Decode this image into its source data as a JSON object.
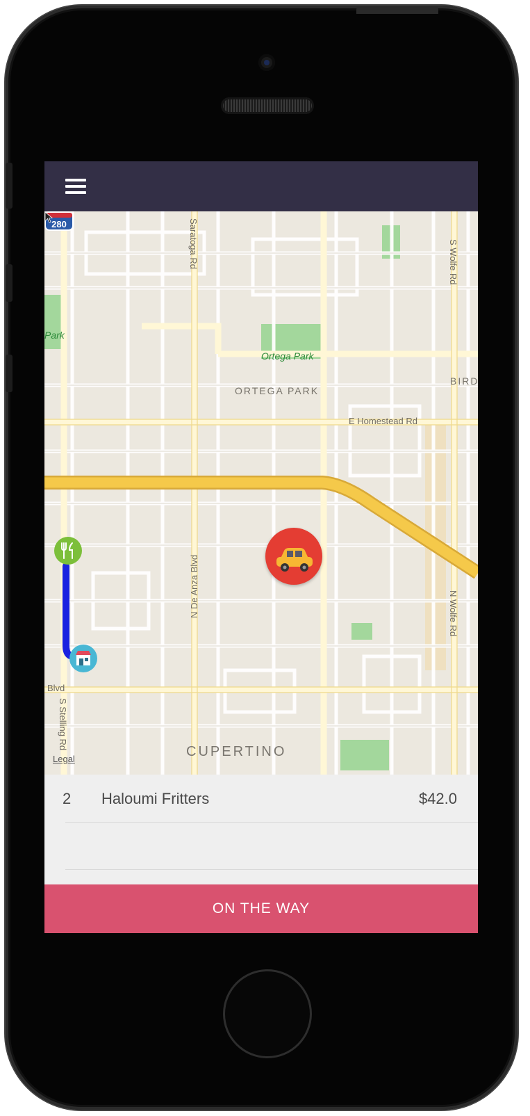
{
  "map": {
    "labels": {
      "road_saratoga": "Saratoga Rd",
      "road_wolfe_s": "S Wolfe Rd",
      "road_wolfe_n": "N Wolfe Rd",
      "road_homestead": "E Homestead Rd",
      "road_blvd": "Blvd",
      "road_stelling": "S Stelling Rd",
      "road_dana": "N De Anza Blvd",
      "park_west": "Park",
      "park_ortega": "Ortega Park",
      "area_ortega": "ORTEGA PARK",
      "area_bird": "BIRD",
      "city": "CUPERTINO",
      "highway": "280",
      "legal": "Legal"
    },
    "colors": {
      "route": "#1a22e0",
      "major_road": "#f5c94a",
      "park": "#9fd69a",
      "car_marker": "#e43d33"
    },
    "icons": [
      "menu-icon",
      "car-icon",
      "restaurant-icon",
      "store-icon",
      "cursor-icon"
    ]
  },
  "order": {
    "items": [
      {
        "qty": "2",
        "name": "Haloumi Fritters",
        "price": "$42.0"
      }
    ]
  },
  "action": {
    "label": "ON THE WAY",
    "color": "#d9526f"
  },
  "navbar": {
    "color": "#332f46"
  }
}
